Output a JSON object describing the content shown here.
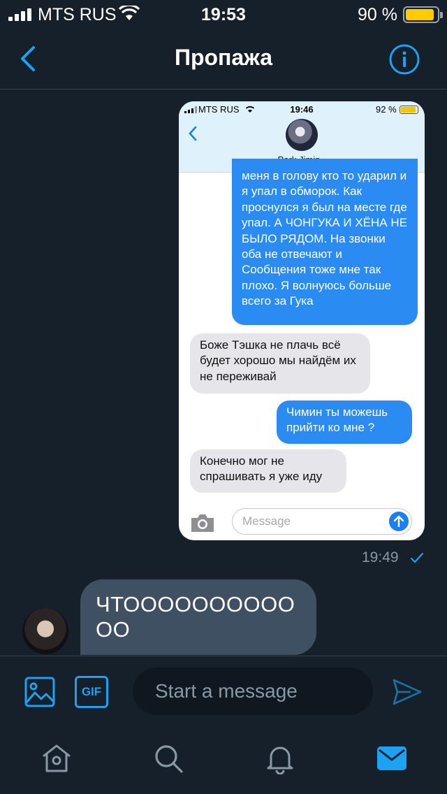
{
  "status_bar": {
    "carrier": "MTS RUS",
    "time": "19:53",
    "battery_percent": "90 %",
    "battery_level": 0.9,
    "battery_color": "#ffcc00"
  },
  "header": {
    "title": "Пропажа",
    "back_icon": "chevron-left-icon",
    "info_icon": "info-icon"
  },
  "shared_image": {
    "status_bar": {
      "carrier": "MTS RUS",
      "time": "19:46",
      "battery_percent": "92 %"
    },
    "contact_name": "Park Jimin",
    "messages": [
      {
        "direction": "out",
        "text": "меня в голову кто то ударил и я упал в обморок. Как проснулся я был на месте где упал. А ЧОНГУКА И ХЁНА НЕ БЫЛО РЯДОМ. На звонки оба не отвечают и Сообщения тоже мне так плохо. Я волнуюсь больше всего за Гука"
      },
      {
        "direction": "in",
        "text": "Боже Тэшка не плачь всё будет хорошо мы найдём их не переживай"
      },
      {
        "direction": "out",
        "text": "Чимин ты можешь прийти ко мне ?"
      },
      {
        "direction": "in",
        "text": "Конечно мог не спрашивать я уже иду"
      }
    ],
    "input_placeholder": "Message"
  },
  "sent_time": "19:49",
  "incoming_message": {
    "text": "ЧТОООООООООООО"
  },
  "composer": {
    "gif_label": "GIF",
    "placeholder": "Start a message"
  },
  "colors": {
    "background": "#15202b",
    "accent": "#1da1f2",
    "incoming_bubble": "#3e5062"
  },
  "tab_bar": {
    "items": [
      "home-icon",
      "search-icon",
      "bell-icon",
      "mail-icon"
    ],
    "active": "mail-icon"
  }
}
